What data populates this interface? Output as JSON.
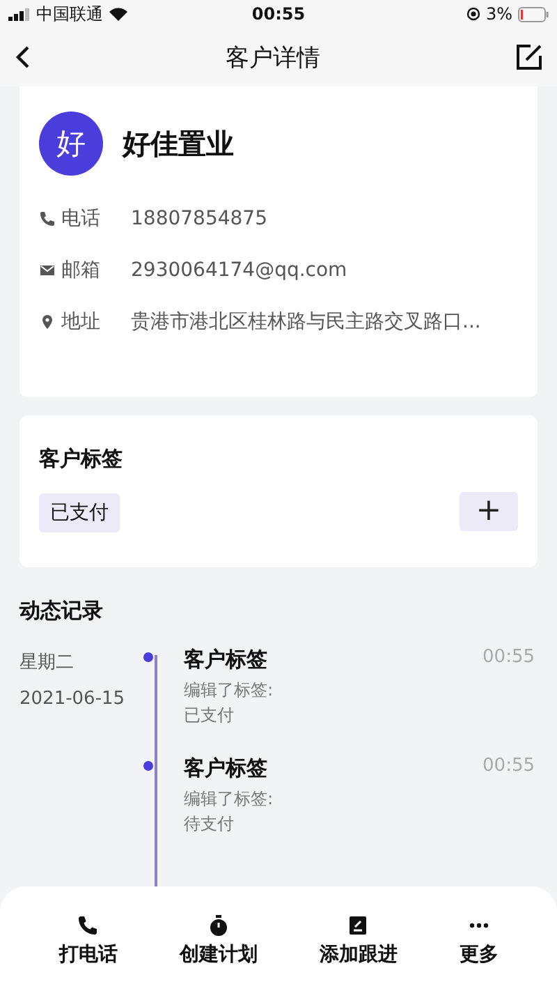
{
  "status_bar": {
    "carrier": "中国联通",
    "time": "00:55",
    "battery": "3%"
  },
  "nav": {
    "title": "客户详情"
  },
  "customer": {
    "avatar": "好",
    "name": "好佳置业",
    "fields": [
      {
        "kind": "phone",
        "label": "电话",
        "value": "18807854875"
      },
      {
        "kind": "mail",
        "label": "邮箱",
        "value": "2930064174@qq.com"
      },
      {
        "kind": "location",
        "label": "地址",
        "value": "贵港市港北区桂林路与民主路交叉路口..."
      }
    ]
  },
  "tags_card": {
    "title": "客户标签",
    "tags": [
      "已支付"
    ],
    "add_button": "+"
  },
  "activity": {
    "title": "动态记录",
    "weekday": "星期二",
    "date": "2021-06-15",
    "entries": [
      {
        "title": "客户标签",
        "time": "00:55",
        "detail": "编辑了标签:",
        "value": "已支付"
      },
      {
        "title": "客户标签",
        "time": "00:55",
        "detail": "编辑了标签:",
        "value": "待支付"
      }
    ]
  },
  "actions": [
    {
      "kind": "phone",
      "label": "打电话"
    },
    {
      "kind": "timer",
      "label": "创建计划"
    },
    {
      "kind": "note",
      "label": "添加跟进"
    },
    {
      "kind": "more",
      "label": "更多"
    }
  ]
}
